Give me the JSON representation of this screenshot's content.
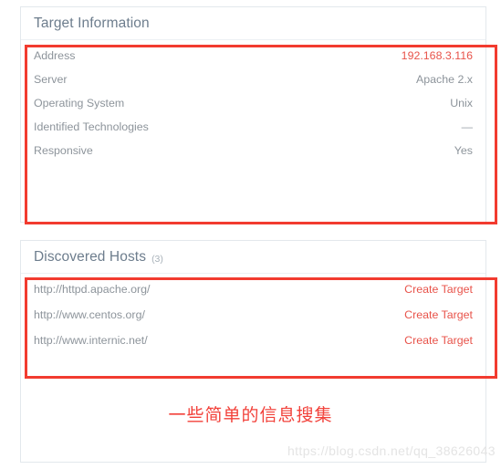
{
  "target_information": {
    "title": "Target Information",
    "rows": [
      {
        "label": "Address",
        "value": "192.168.3.116",
        "style": "link"
      },
      {
        "label": "Server",
        "value": "Apache 2.x",
        "style": "plain"
      },
      {
        "label": "Operating System",
        "value": "Unix",
        "style": "plain"
      },
      {
        "label": "Identified Technologies",
        "value": "—",
        "style": "dash"
      },
      {
        "label": "Responsive",
        "value": "Yes",
        "style": "plain"
      }
    ]
  },
  "discovered_hosts": {
    "title": "Discovered Hosts",
    "count": "(3)",
    "rows": [
      {
        "url": "http://httpd.apache.org/",
        "action": "Create Target"
      },
      {
        "url": "http://www.centos.org/",
        "action": "Create Target"
      },
      {
        "url": "http://www.internic.net/",
        "action": "Create Target"
      }
    ]
  },
  "annotation": {
    "caption": "一些简单的信息搜集",
    "box_color": "#f23b2f"
  },
  "watermark": {
    "text": "https://blog.csdn.net/qq_38626043"
  }
}
